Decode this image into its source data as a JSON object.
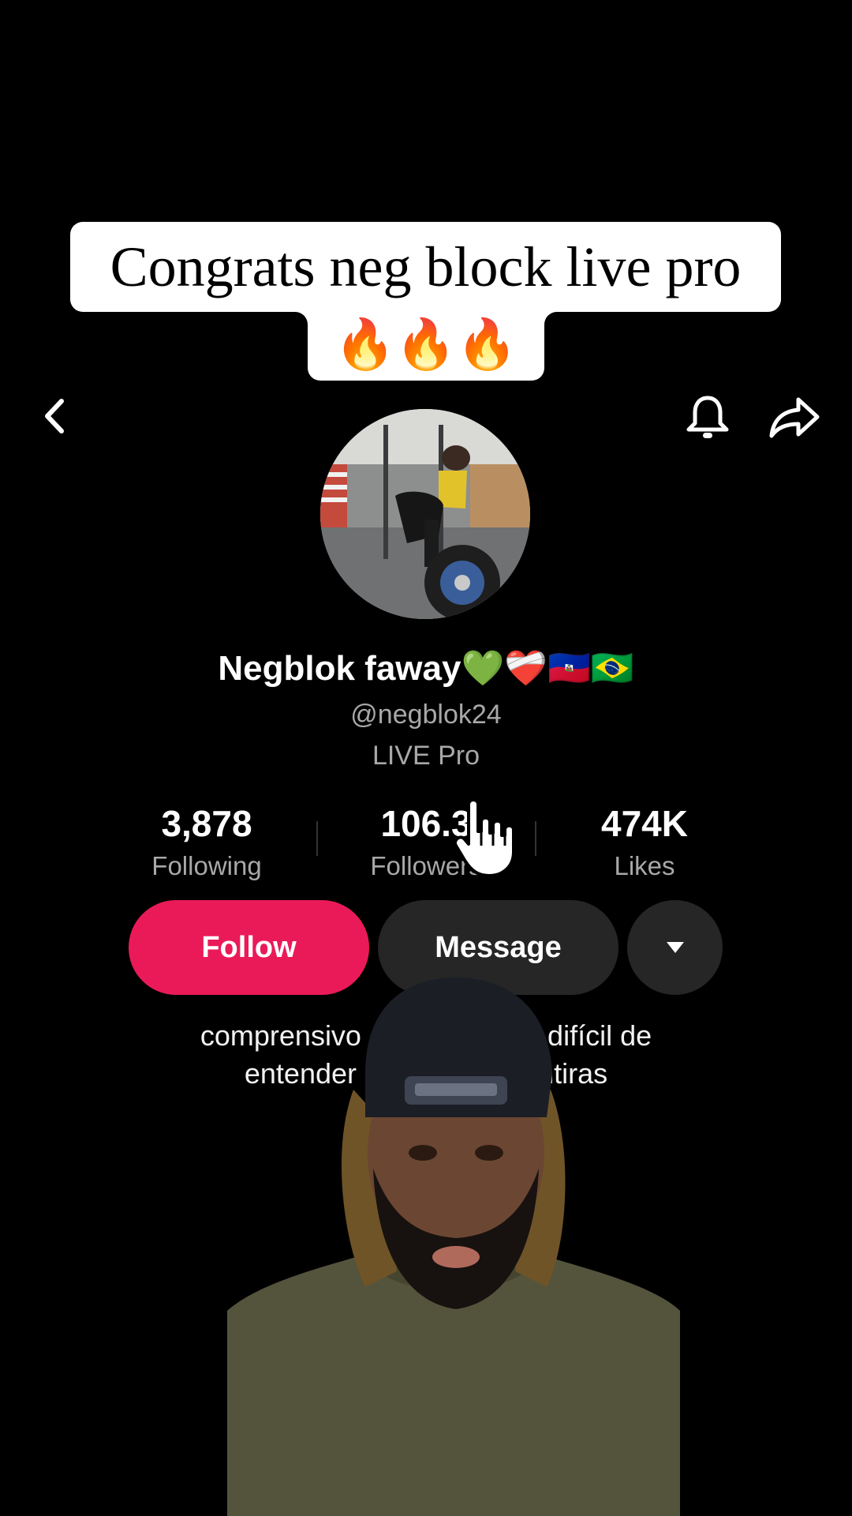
{
  "caption": {
    "line1": "Congrats neg block live pro",
    "line2": "🔥🔥🔥"
  },
  "nav": {
    "back_icon": "chevron-left-icon",
    "bell_icon": "bell-icon",
    "share_icon": "share-arrow-icon"
  },
  "profile": {
    "display_name": "Negblok faway💚❤️‍🩹🇭🇹🇧🇷",
    "handle": "@negblok24",
    "badge": "LIVE Pro"
  },
  "stats": {
    "following_value": "3,878",
    "following_label": "Following",
    "followers_value": "106.3",
    "followers_label": "Followers",
    "likes_value": "474K",
    "likes_label": "Likes"
  },
  "actions": {
    "follow_label": "Follow",
    "message_label": "Message",
    "more_icon": "caret-down-icon"
  },
  "bio": {
    "line1": "comprensivo con lo             difícil de",
    "line2": "entender no me            ntiras"
  },
  "colors": {
    "follow_accent": "#ea1a58",
    "secondary_button": "#262626",
    "background": "#000000"
  }
}
